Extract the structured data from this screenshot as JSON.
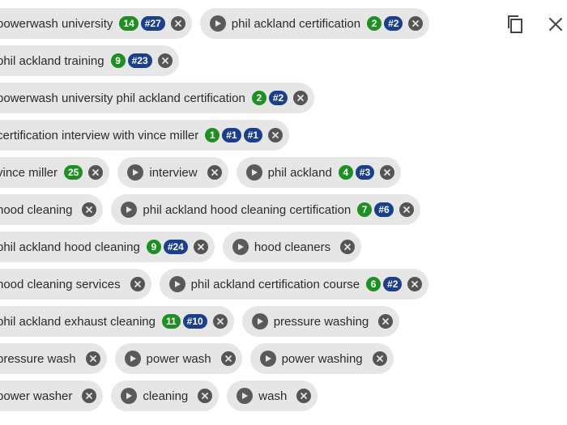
{
  "toolbar": {
    "copy_icon": "copy-icon",
    "close_icon": "close-icon"
  },
  "colors": {
    "chip_bg": "#e6e6e6",
    "rank_green": "#1f8f24",
    "rank_blue": "#1c3f8c"
  },
  "rows": [
    [
      {
        "label": "powerwash university",
        "play": false,
        "badges": [
          {
            "text": "14",
            "color": "green"
          },
          {
            "text": "#27",
            "color": "blue"
          }
        ]
      },
      {
        "label": "phil ackland certification",
        "play": true,
        "badges": [
          {
            "text": "2",
            "color": "green"
          },
          {
            "text": "#2",
            "color": "blue"
          }
        ]
      }
    ],
    [
      {
        "label": "phil ackland training",
        "play": false,
        "badges": [
          {
            "text": "9",
            "color": "green"
          },
          {
            "text": "#23",
            "color": "blue"
          }
        ]
      }
    ],
    [
      {
        "label": "powerwash university phil ackland certification",
        "play": false,
        "badges": [
          {
            "text": "2",
            "color": "green"
          },
          {
            "text": "#2",
            "color": "blue"
          }
        ]
      }
    ],
    [
      {
        "label": "certification interview with vince miller",
        "play": false,
        "badges": [
          {
            "text": "1",
            "color": "green"
          },
          {
            "text": "#1",
            "color": "blue"
          },
          {
            "text": "#1",
            "color": "blue"
          }
        ]
      }
    ],
    [
      {
        "label": "vince miller",
        "play": false,
        "badges": [
          {
            "text": "25",
            "color": "green"
          }
        ]
      },
      {
        "label": "interview",
        "play": true,
        "badges": []
      },
      {
        "label": "phil ackland",
        "play": true,
        "badges": [
          {
            "text": "4",
            "color": "green"
          },
          {
            "text": "#3",
            "color": "blue"
          }
        ]
      }
    ],
    [
      {
        "label": "hood cleaning",
        "play": false,
        "badges": []
      },
      {
        "label": "phil ackland hood cleaning certification",
        "play": true,
        "badges": [
          {
            "text": "7",
            "color": "green"
          },
          {
            "text": "#6",
            "color": "blue"
          }
        ]
      }
    ],
    [
      {
        "label": "phil ackland hood cleaning",
        "play": false,
        "badges": [
          {
            "text": "9",
            "color": "green"
          },
          {
            "text": "#24",
            "color": "blue"
          }
        ]
      },
      {
        "label": "hood cleaners",
        "play": true,
        "badges": []
      }
    ],
    [
      {
        "label": "hood cleaning services",
        "play": false,
        "badges": []
      },
      {
        "label": "phil ackland certification course",
        "play": true,
        "badges": [
          {
            "text": "6",
            "color": "green"
          },
          {
            "text": "#2",
            "color": "blue"
          }
        ]
      }
    ],
    [
      {
        "label": "phil ackland exhaust cleaning",
        "play": false,
        "badges": [
          {
            "text": "11",
            "color": "green"
          },
          {
            "text": "#10",
            "color": "blue"
          }
        ]
      },
      {
        "label": "pressure washing",
        "play": true,
        "badges": []
      }
    ],
    [
      {
        "label": "pressure wash",
        "play": false,
        "badges": []
      },
      {
        "label": "power wash",
        "play": true,
        "badges": []
      },
      {
        "label": "power washing",
        "play": true,
        "badges": []
      }
    ],
    [
      {
        "label": "power washer",
        "play": false,
        "badges": []
      },
      {
        "label": "cleaning",
        "play": true,
        "badges": []
      },
      {
        "label": "wash",
        "play": true,
        "badges": []
      }
    ]
  ]
}
